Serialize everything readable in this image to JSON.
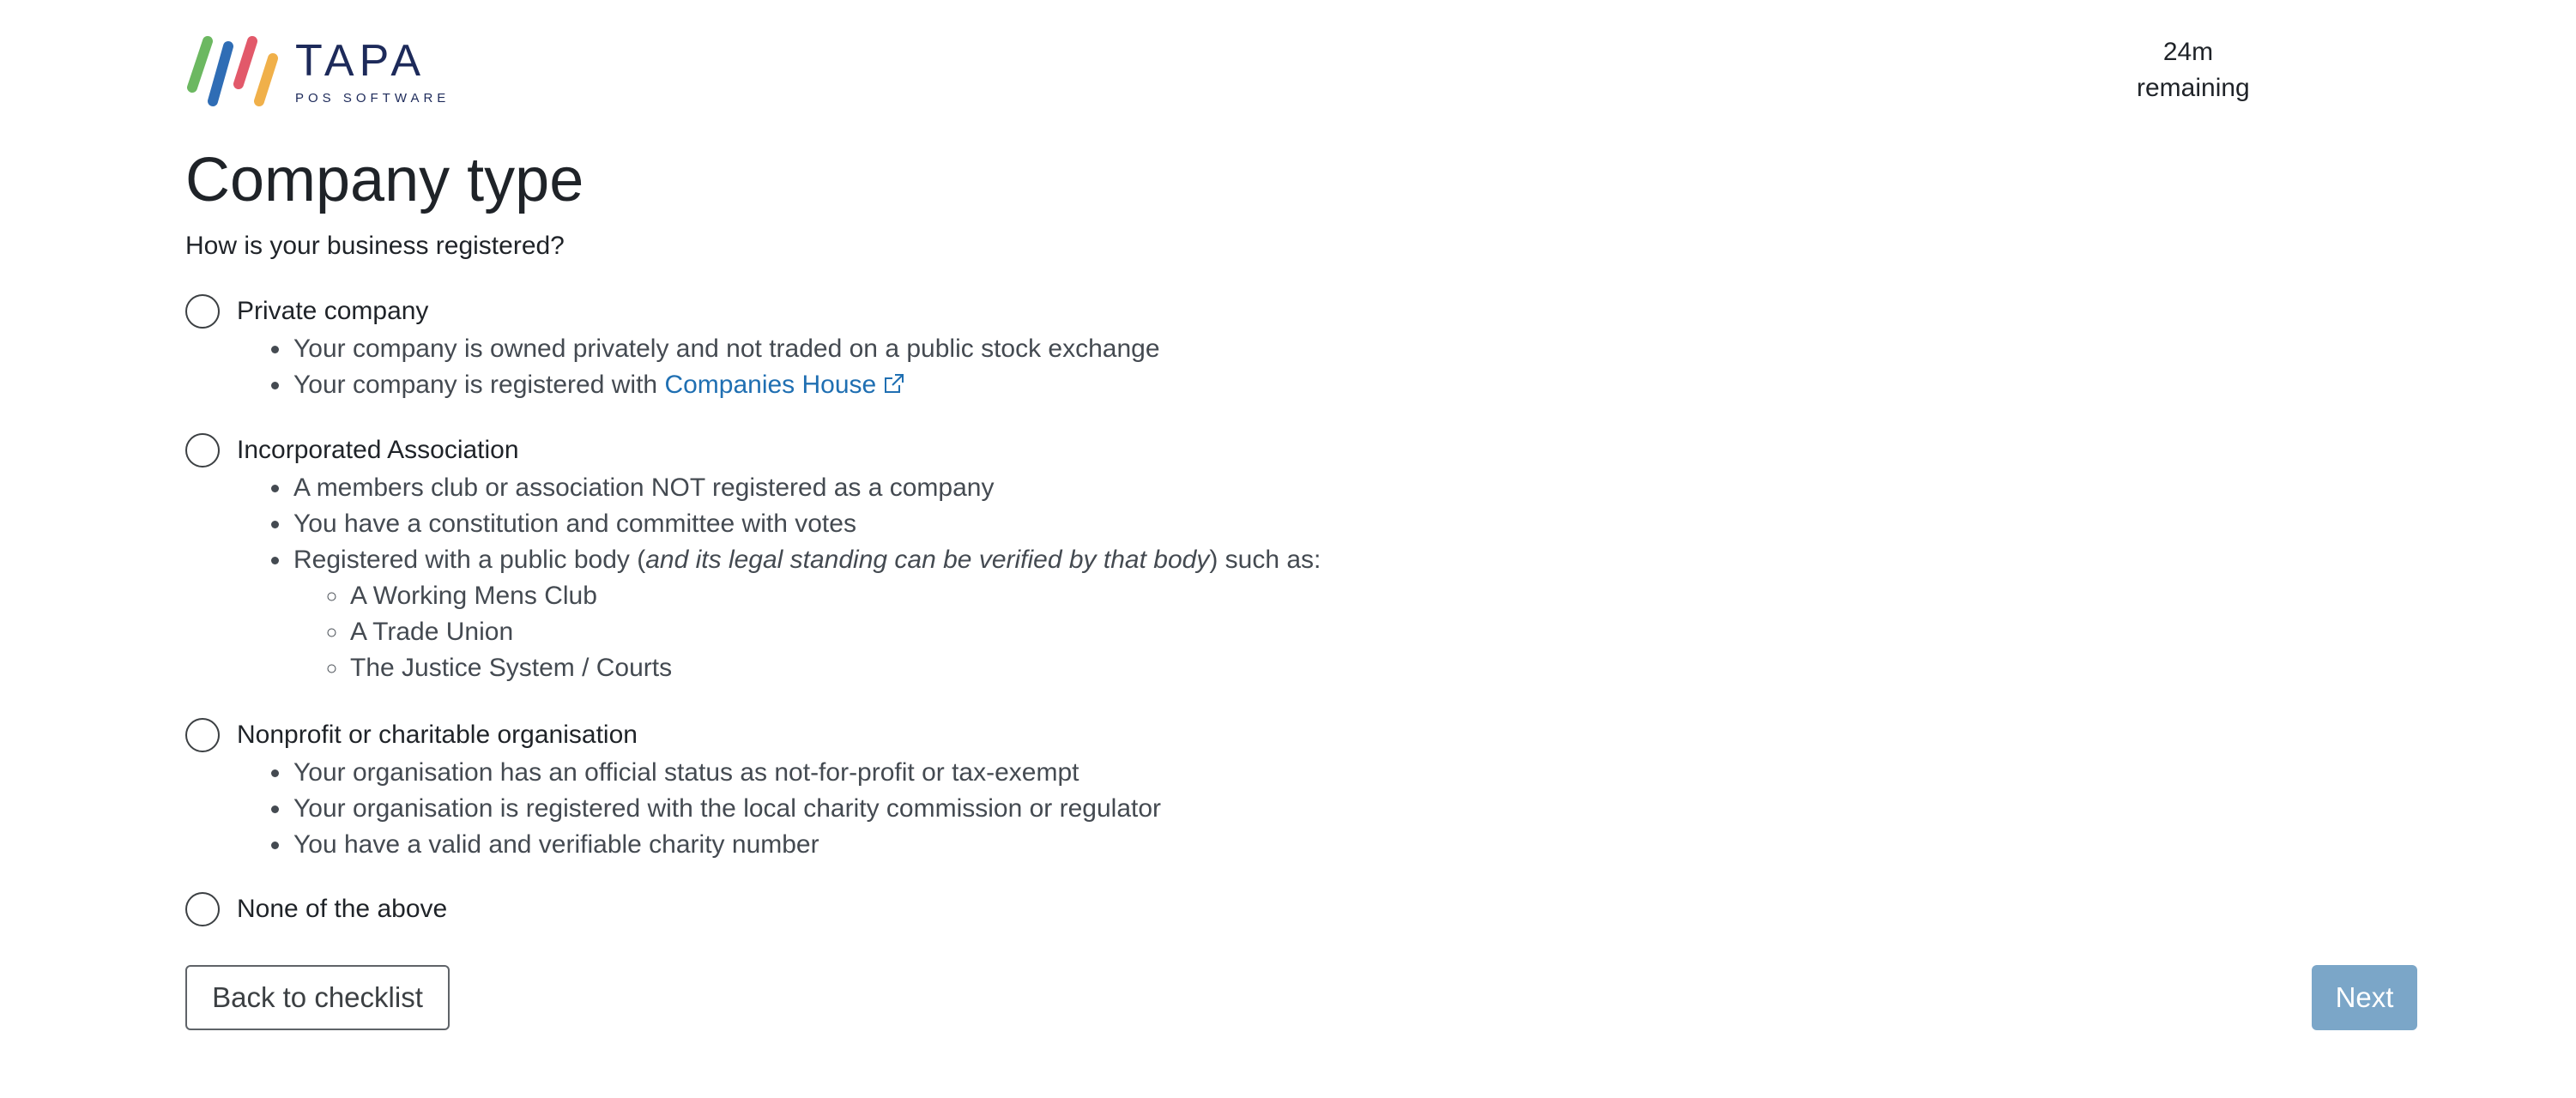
{
  "logo": {
    "name": "TAPA",
    "subtitle": "POS SOFTWARE",
    "stripe_colors": [
      "#6cb861",
      "#2f6db5",
      "#e2596a",
      "#f0b04a"
    ]
  },
  "timer": {
    "value": "24m",
    "label": "remaining"
  },
  "page": {
    "title": "Company type",
    "question": "How is your business registered?"
  },
  "options": [
    {
      "label": "Private company",
      "selected": false,
      "bullets": [
        "Your company is owned privately and not traded on a public stock exchange",
        "Your company is registered with "
      ],
      "link_text": "Companies House",
      "link_icon": "external-link-icon"
    },
    {
      "label": "Incorporated Association",
      "selected": false,
      "bullets": [
        "A members club or association NOT registered as a company",
        "You have a constitution and committee with votes",
        "Registered with a public body ("
      ],
      "bullet3_italic": "and its legal standing can be verified by that body",
      "bullet3_end": ") such as:",
      "sub_bullets": [
        "A Working Mens Club",
        "A Trade Union",
        "The Justice System / Courts"
      ]
    },
    {
      "label": "Nonprofit or charitable organisation",
      "selected": false,
      "bullets": [
        "Your organisation has an official status as not-for-profit or tax-exempt",
        "Your organisation is registered with the local charity commission or regulator",
        "You have a valid and verifiable charity number"
      ]
    },
    {
      "label": "None of the above",
      "selected": false,
      "bullets": []
    }
  ],
  "buttons": {
    "back": "Back to checklist",
    "next": "Next"
  },
  "colors": {
    "link": "#1f6fb2",
    "next_button": "#7ba6c8",
    "brand_text": "#1d2a5a"
  }
}
